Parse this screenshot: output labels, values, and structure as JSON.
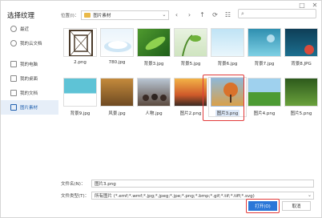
{
  "dialog": {
    "title": "选择纹理",
    "window_controls": [
      "□",
      "✕"
    ]
  },
  "sidebar": {
    "items": [
      {
        "label": "最近",
        "icon": "clock-icon"
      },
      {
        "label": "我的云文档",
        "icon": "cloud-icon"
      },
      {
        "label": "我的电脑",
        "icon": "monitor-icon"
      },
      {
        "label": "我的桌面",
        "icon": "desktop-icon"
      },
      {
        "label": "我的文档",
        "icon": "document-icon"
      },
      {
        "label": "图片素材",
        "icon": "folder-icon",
        "active": true
      }
    ]
  },
  "toolbar": {
    "location_label": "位置(I)：",
    "path": "图片素材",
    "back_icon": "‹",
    "forward_icon": "›",
    "up_icon": "↑",
    "refresh_icon": "⟳",
    "view_icon": "☷",
    "search_icon": "⌕",
    "search_value": ""
  },
  "files": [
    {
      "name": "2.png",
      "thumb": "pattern"
    },
    {
      "name": "780.jpg",
      "thumb": "cloud"
    },
    {
      "name": "背景3.jpg",
      "thumb": "leaf"
    },
    {
      "name": "背景5.jpg",
      "thumb": "plant"
    },
    {
      "name": "背景6.jpg",
      "thumb": "sky"
    },
    {
      "name": "背景7.jpg",
      "thumb": "ocean"
    },
    {
      "name": "背景8.JPG",
      "thumb": "dark"
    },
    {
      "name": "背景9.jpg",
      "thumb": "water"
    },
    {
      "name": "风景.jpg",
      "thumb": "autumn"
    },
    {
      "name": "人物.jpg",
      "thumb": "people"
    },
    {
      "name": "图片2.png",
      "thumb": "sunset"
    },
    {
      "name": "图片3.png",
      "thumb": "tree",
      "selected": true
    },
    {
      "name": "图片4.png",
      "thumb": "meadow"
    },
    {
      "name": "图片5.png",
      "thumb": "forest"
    }
  ],
  "footer": {
    "filename_label": "文件名(N)：",
    "filename_value": "图片3.png",
    "filetype_label": "文件类型(T)：",
    "filetype_value": "所有图片 (*.emf;*.wmf;*.jpg;*.jpeg;*.jpe;*.png;*.bmp;*.gif;*.tif;*.tiff;*.svg)",
    "open_label": "打开(O)",
    "cancel_label": "取消"
  },
  "colors": {
    "accent": "#2b77d8",
    "highlight_box": "#e23b3b",
    "selection": "#dbe7f7"
  }
}
